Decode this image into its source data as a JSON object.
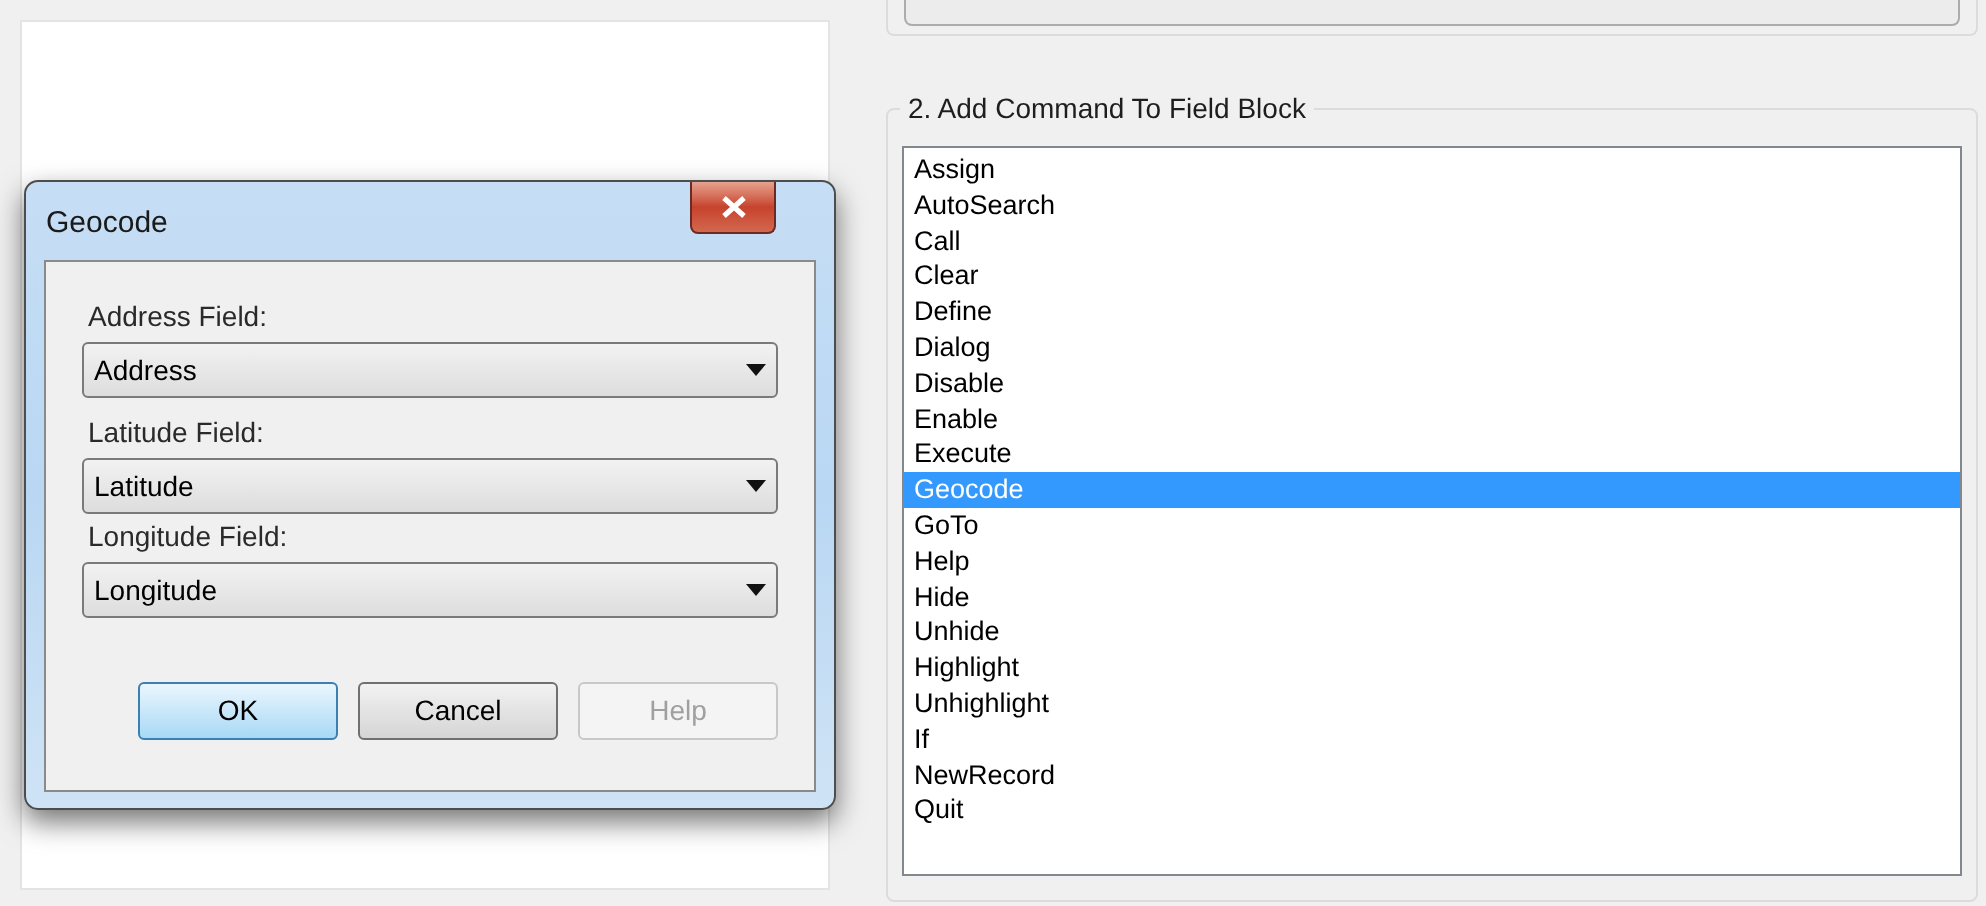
{
  "dialog": {
    "title": "Geocode",
    "fields": [
      {
        "label": "Address Field:",
        "value": "Address"
      },
      {
        "label": "Latitude Field:",
        "value": "Latitude"
      },
      {
        "label": "Longitude Field:",
        "value": "Longitude"
      }
    ],
    "buttons": [
      {
        "label": "OK",
        "default": true,
        "disabled": false
      },
      {
        "label": "Cancel",
        "default": false,
        "disabled": false
      },
      {
        "label": "Help",
        "default": false,
        "disabled": true
      }
    ]
  },
  "command_group": {
    "title": "2. Add Command To Field Block",
    "items": [
      {
        "label": "Assign",
        "selected": false
      },
      {
        "label": "AutoSearch",
        "selected": false
      },
      {
        "label": "Call",
        "selected": false
      },
      {
        "label": "Clear",
        "selected": false
      },
      {
        "label": "Define",
        "selected": false
      },
      {
        "label": "Dialog",
        "selected": false
      },
      {
        "label": "Disable",
        "selected": false
      },
      {
        "label": "Enable",
        "selected": false
      },
      {
        "label": "Execute",
        "selected": false
      },
      {
        "label": "Geocode",
        "selected": true
      },
      {
        "label": "GoTo",
        "selected": false
      },
      {
        "label": "Help",
        "selected": false
      },
      {
        "label": "Hide",
        "selected": false
      },
      {
        "label": "Unhide",
        "selected": false
      },
      {
        "label": "Highlight",
        "selected": false
      },
      {
        "label": "Unhighlight",
        "selected": false
      },
      {
        "label": "If",
        "selected": false
      },
      {
        "label": "NewRecord",
        "selected": false
      },
      {
        "label": "Quit",
        "selected": false
      }
    ]
  }
}
